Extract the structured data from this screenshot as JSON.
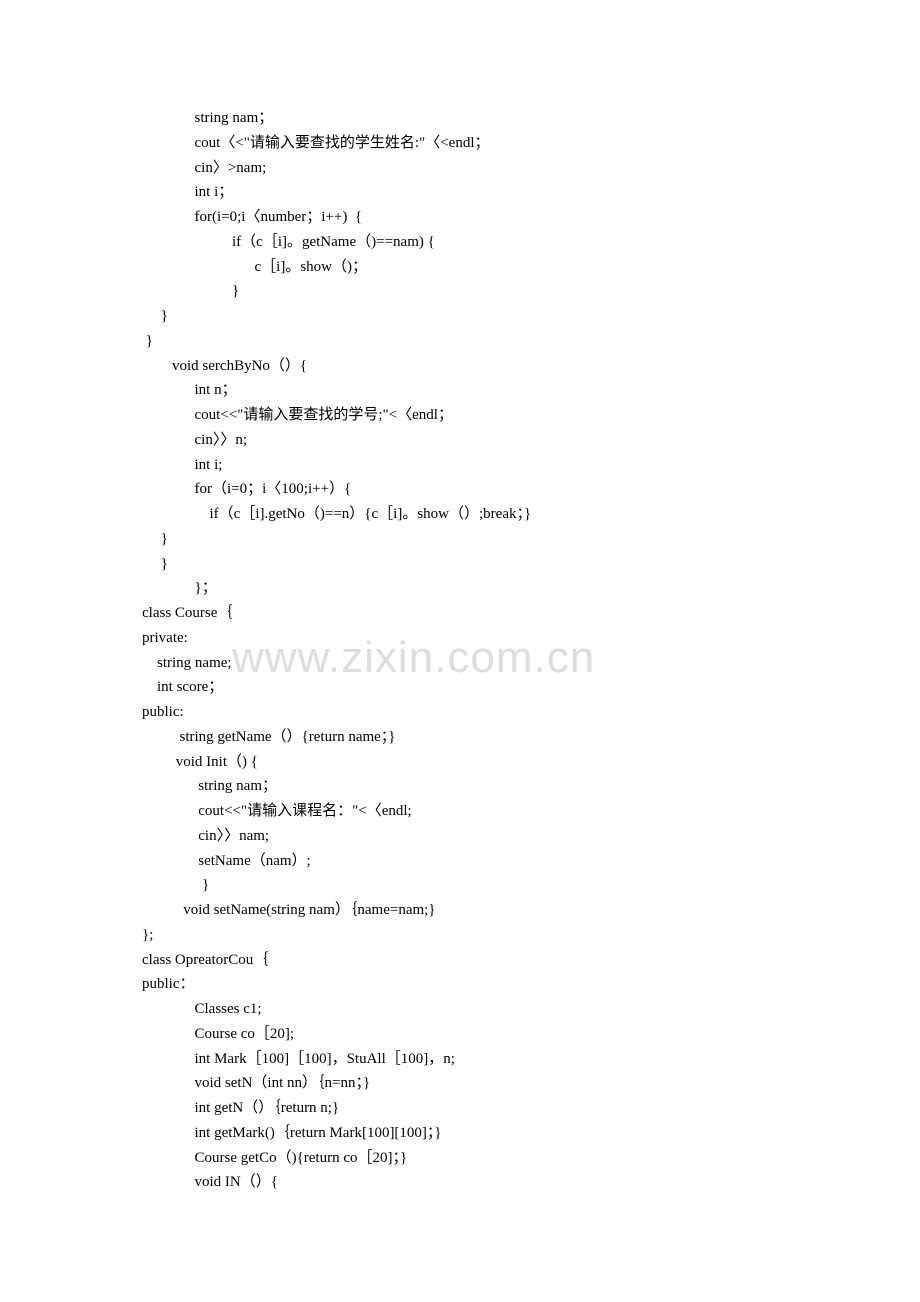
{
  "watermark": "www.zixin.com.cn",
  "code": "              string nam；\n              cout〈<\"请输入要查找的学生姓名:\"〈<endl；\n              cin〉>nam;\n              int i；\n              for(i=0;i〈number；i++)  {\n                        if（c［i]。getName（)==nam) {\n                              c［i]。show（)；\n                        }\n     }\n }\n        void serchByNo（）{\n              int n；\n              cout<<\"请输入要查找的学号;\"<〈endl；\n              cin〉〉n;\n              int i;\n              for（i=0；i〈100;i++）{\n                  if（c［i].getNo（)==n）{c［i]。show（）;break；}\n     }\n     }\n              }；\nclass Course｛\nprivate:\n    string name;\n    int score；\npublic:\n          string getName（）{return name；}\n         void Init（) {\n               string nam；\n               cout<<\"请输入课程名：\"<〈endl;\n               cin〉〉nam;\n               setName（nam）;\n                }\n           void setName(string nam）｛name=nam;}\n};\nclass OpreatorCou｛\npublic：\n              Classes c1;\n              Course co［20];\n              int Mark［100]［100]，StuAll［100]，n;\n              void setN（int nn）｛n=nn；}\n              int getN（）｛return n;}\n              int getMark()｛return Mark[100][100]；}\n              Course getCo（){return co［20]；}\n              void IN（）{"
}
